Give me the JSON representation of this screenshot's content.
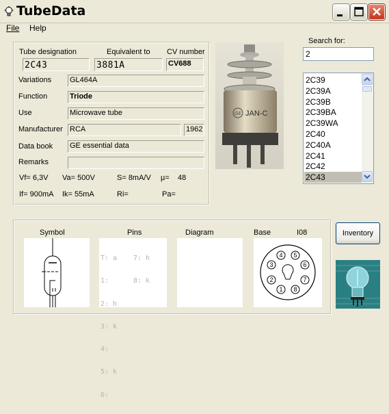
{
  "window": {
    "title": "TubeData"
  },
  "menu": {
    "file": "File",
    "help": "Help"
  },
  "details": {
    "tube_designation_label": "Tube designation",
    "tube_designation": "2C43",
    "equivalent_label": "Equivalent to",
    "equivalent": "3881A",
    "cv_label": "CV number",
    "cv": "CV688",
    "variations_label": "Variations",
    "variations": "GL464A",
    "function_label": "Function",
    "function": "Triode",
    "use_label": "Use",
    "use": "Microwave tube",
    "manufacturer_label": "Manufacturer",
    "manufacturer": "RCA",
    "year": "1962",
    "databook_label": "Data book",
    "databook": "GE essential data",
    "remarks_label": "Remarks",
    "remarks": "",
    "params": {
      "vf": "Vf= 6,3V",
      "va": "Va= 500V",
      "s": "S= 8mA/V",
      "mu_label": "µ=",
      "mu": "48",
      "if": "If= 900mA",
      "ik": "Ik= 55mA",
      "ri": "Ri=",
      "pa": "Pa="
    }
  },
  "search": {
    "label": "Search for:",
    "value": "2",
    "results": [
      "2C39",
      "2C39A",
      "2C39B",
      "2C39BA",
      "2C39WA",
      "2C40",
      "2C40A",
      "2C41",
      "2C42",
      "2C43"
    ],
    "selected": "2C43"
  },
  "bottom": {
    "symbol_label": "Symbol",
    "pins_label": "Pins",
    "diagram_label": "Diagram",
    "base_label": "Base",
    "base_type": "I08",
    "pins": [
      {
        "left": "T: a",
        "right": "7: h"
      },
      {
        "left": "1:",
        "right": "8: k"
      },
      {
        "left": "2: h",
        "right": ""
      },
      {
        "left": "3: k",
        "right": ""
      },
      {
        "left": "4:",
        "right": ""
      },
      {
        "left": "5: k",
        "right": ""
      },
      {
        "left": "6:",
        "right": ""
      }
    ],
    "base_pins": [
      "1",
      "2",
      "3",
      "4",
      "5",
      "6",
      "7",
      "8"
    ]
  },
  "inventory_button": "Inventory",
  "photo_label": "JAN-C",
  "photo_logo": "GE",
  "colors": {
    "close": "#c2351a",
    "window_bg": "#ece9d8",
    "list_border": "#7f9db9"
  }
}
